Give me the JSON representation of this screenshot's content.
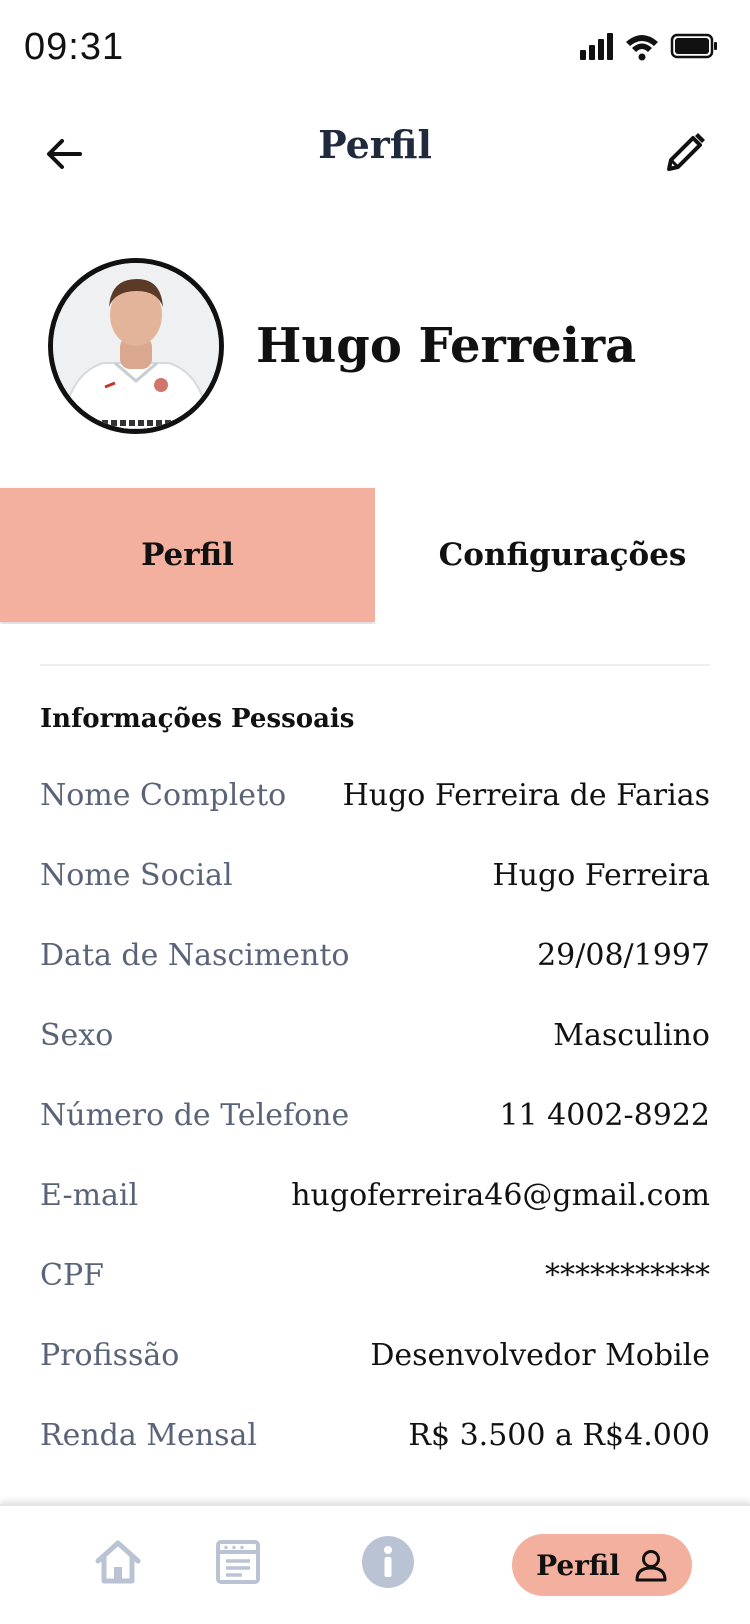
{
  "status_bar": {
    "time": "09:31"
  },
  "header": {
    "title": "Perfil"
  },
  "profile": {
    "name": "Hugo Ferreira"
  },
  "tabs": [
    {
      "label": "Perfil",
      "active": true
    },
    {
      "label": "Configurações",
      "active": false
    }
  ],
  "section": {
    "title": "Informações Pessoais",
    "rows": [
      {
        "label": "Nome Completo",
        "value": "Hugo Ferreira de Farias"
      },
      {
        "label": "Nome Social",
        "value": "Hugo Ferreira"
      },
      {
        "label": "Data de Nascimento",
        "value": "29/08/1997"
      },
      {
        "label": "Sexo",
        "value": "Masculino"
      },
      {
        "label": "Número de Telefone",
        "value": "11 4002-8922"
      },
      {
        "label": "E-mail",
        "value": "hugoferreira46@gmail.com"
      },
      {
        "label": "CPF",
        "value": "***********"
      },
      {
        "label": "Profissão",
        "value": "Desenvolvedor Mobile"
      },
      {
        "label": "Renda Mensal",
        "value": "R$ 3.500 a R$4.000"
      }
    ]
  },
  "bottom_nav": {
    "items": [
      {
        "icon": "home-icon"
      },
      {
        "icon": "newspaper-icon"
      },
      {
        "icon": "info-icon"
      }
    ],
    "active_label": "Perfil",
    "active_icon": "user-icon"
  },
  "colors": {
    "accent": "#f4b09e",
    "label": "#5a6478",
    "title": "#1f2a3d",
    "nav_inactive": "#b9c3d3"
  }
}
